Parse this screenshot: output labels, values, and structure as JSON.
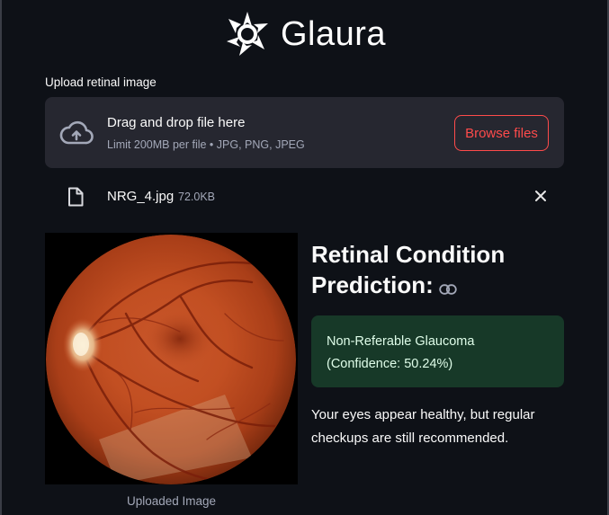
{
  "app": {
    "logo_text": "Glaura",
    "logo_icon": "star-burst-icon"
  },
  "uploader": {
    "label": "Upload retinal image",
    "drop_title": "Drag and drop file here",
    "drop_limits": "Limit 200MB per file • JPG, PNG, JPEG",
    "browse_label": "Browse files",
    "cloud_icon": "cloud-upload-icon"
  },
  "file": {
    "name": "NRG_4.jpg",
    "size": "72.0KB",
    "file_icon": "document-icon",
    "close_icon": "close-icon"
  },
  "image": {
    "caption": "Uploaded Image"
  },
  "result": {
    "heading": "Retinal Condition Prediction:",
    "label": "Non-Referable Glaucoma",
    "confidence": "(Confidence: 50.24%)",
    "message": "Your eyes appear healthy, but regular checkups are still recommended.",
    "link_icon": "link-icon"
  },
  "colors": {
    "background": "#0e1117",
    "panel": "#262730",
    "accent": "#ff4b4b",
    "success_bg": "#173928",
    "success_text": "#dffde9"
  }
}
